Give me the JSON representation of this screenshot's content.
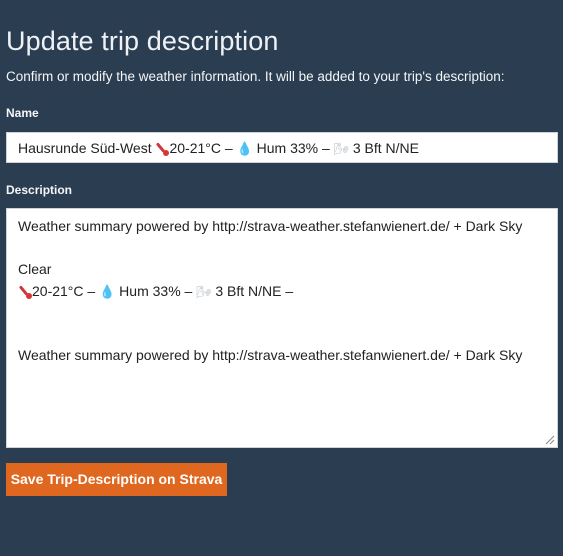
{
  "page": {
    "title": "Update trip description",
    "subtitle": "Confirm or modify the weather information. It will be added to your trip's description:"
  },
  "name_field": {
    "label": "Name",
    "value_prefix": "Hausrunde Süd-West ",
    "temp": "20-21°C – ",
    "humidity": " Hum 33% – ",
    "wind": " 3 Bft  N/NE"
  },
  "description_field": {
    "label": "Description",
    "line1": "Weather summary powered by http://strava-weather.stefanwienert.de/ + Dark Sky",
    "line2": "Clear",
    "temp": "20-21°C – ",
    "humidity": " Hum 33% – ",
    "wind": " 3 Bft  N/NE –",
    "line4": "Weather summary powered by http://strava-weather.stefanwienert.de/ + Dark Sky"
  },
  "icons": {
    "thermometer": "thermometer-icon",
    "droplet": "droplet-icon",
    "wind": "wind-icon"
  },
  "colors": {
    "background": "#2b3e51",
    "button": "#e0671f"
  },
  "button": {
    "label": "Save Trip-Description on Strava"
  }
}
